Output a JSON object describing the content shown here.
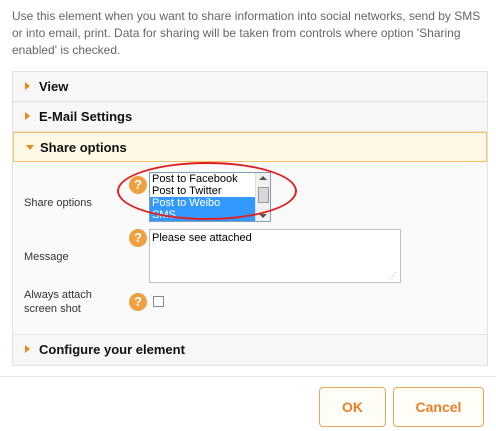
{
  "description": "Use this element when you want to share information into social networks, send by SMS or into email, print. Data for sharing will be taken from controls where option 'Sharing enabled' is checked.",
  "sections": {
    "view": "View",
    "email_settings": "E-Mail Settings",
    "share_options": "Share options",
    "configure": "Configure your element"
  },
  "share_options_form": {
    "share_label": "Share options",
    "options": [
      "Post to Facebook",
      "Post to Twitter",
      "Post to Weibo",
      "SMS"
    ],
    "selected": [
      "Post to Weibo",
      "SMS"
    ],
    "message_label": "Message",
    "message_value": "Please see attached",
    "screenshot_label_1": "Always attach",
    "screenshot_label_2": "screen shot",
    "screenshot_checked": false,
    "help_glyph": "?"
  },
  "buttons": {
    "ok": "OK",
    "cancel": "Cancel"
  },
  "colors": {
    "accent": "#e8881e",
    "highlight_ring": "#e02020",
    "selection": "#3399ff"
  },
  "icons": {
    "collapsed": "chevron-right-icon",
    "expanded": "chevron-down-icon",
    "help": "help-icon"
  }
}
